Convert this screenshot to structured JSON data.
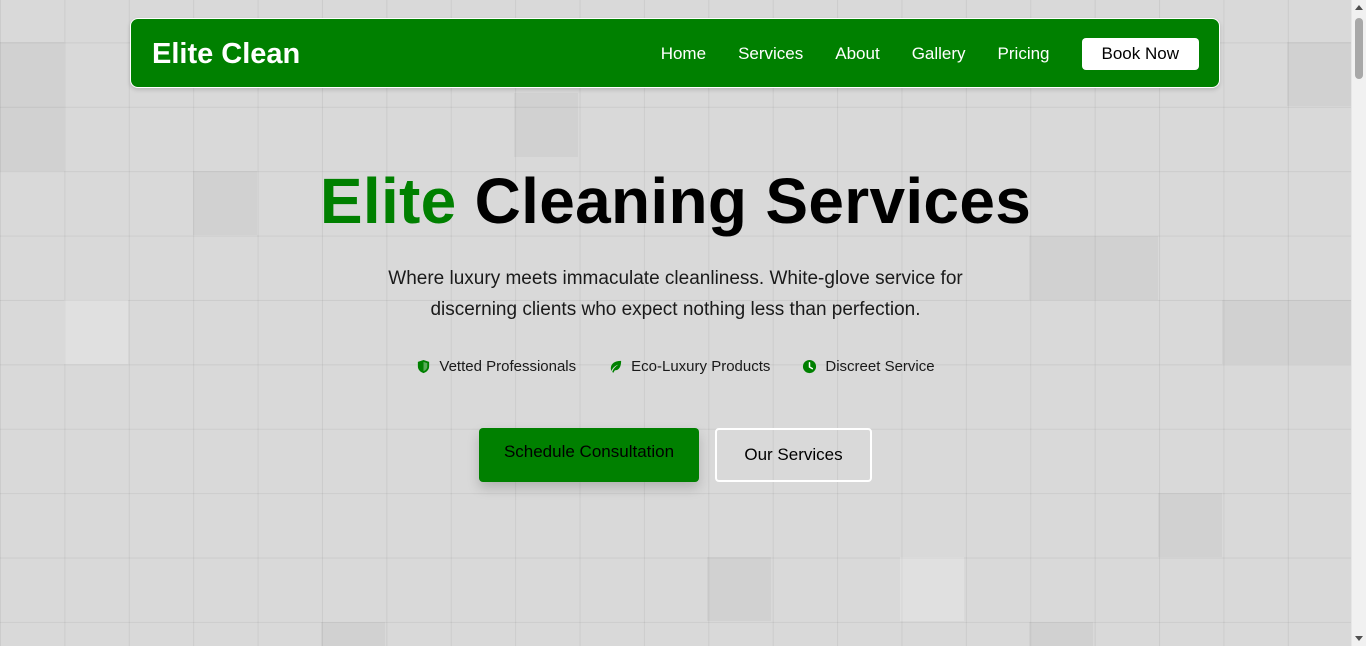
{
  "navbar": {
    "brand": "Elite Clean",
    "links": [
      "Home",
      "Services",
      "About",
      "Gallery",
      "Pricing"
    ],
    "cta": "Book Now"
  },
  "hero": {
    "title_accent": "Elite",
    "title_rest": " Cleaning Services",
    "subtitle": "Where luxury meets immaculate cleanliness. White-glove service for discerning clients who expect nothing less than perfection.",
    "features": [
      {
        "icon": "shield-icon",
        "label": "Vetted Professionals"
      },
      {
        "icon": "leaf-icon",
        "label": "Eco-Luxury Products"
      },
      {
        "icon": "clock-icon",
        "label": "Discreet Service"
      }
    ],
    "primary_button": "Schedule Consultation",
    "secondary_button": "Our Services"
  },
  "colors": {
    "brand_green": "#008000",
    "background": "#d9d9d9",
    "text": "#000000"
  }
}
